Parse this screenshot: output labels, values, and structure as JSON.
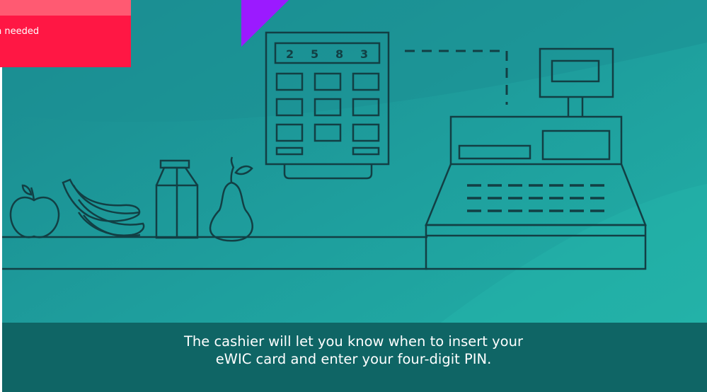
{
  "notification": {
    "text": "n needed"
  },
  "keypad": {
    "digits": [
      "2",
      "5",
      "8",
      "3"
    ]
  },
  "caption": {
    "line1": "The cashier will let you know when to insert your",
    "line2": "eWIC card and enter your four-digit PIN."
  },
  "colors": {
    "background": "#1e9d9d",
    "line_art": "#123f44",
    "caption_bar": "#0f6565",
    "notification": "#ff1744",
    "accent_triangle": "#9b1aff"
  },
  "icons": [
    "apple-icon",
    "banana-icon",
    "milk-carton-icon",
    "pear-icon",
    "card-reader-icon",
    "cash-register-icon"
  ]
}
